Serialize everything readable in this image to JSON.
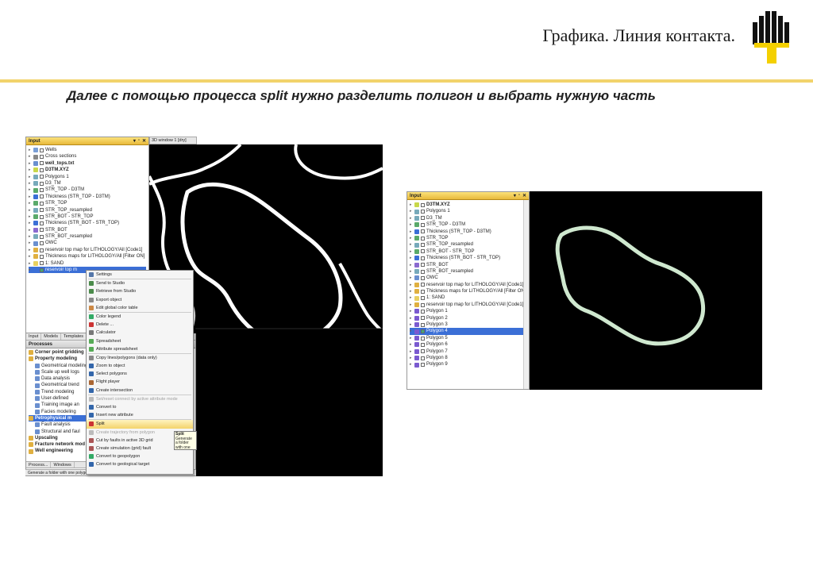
{
  "slide": {
    "title": "Графика. Линия контакта.",
    "subtitle": "Далее с помощью процесса split нужно разделить полигон и выбрать нужную часть",
    "accent_color": "#f2d36b"
  },
  "left_window": {
    "title": "Input",
    "window_tab": "3D window 1 [dry]",
    "tree": [
      {
        "label": "Wells",
        "icon": "#7a9fd6",
        "bold": false
      },
      {
        "label": "Cross sections",
        "icon": "#888",
        "bold": false
      },
      {
        "label": "well_tops.txt",
        "icon": "#6a8fcf",
        "bold": true
      },
      {
        "label": "D3TM.XYZ",
        "icon": "#c8d84a",
        "bold": true
      },
      {
        "label": "Polygons 1",
        "icon": "#7ab",
        "bold": false
      },
      {
        "label": "D3_TM",
        "icon": "#7ab",
        "bold": false
      },
      {
        "label": "STR_TOP - D3TM",
        "icon": "#5aaa6a",
        "bold": false
      },
      {
        "label": "Thickness (STR_TOP - D3TM)",
        "icon": "#3b6fd6",
        "bold": false
      },
      {
        "label": "STR_TOP",
        "icon": "#5aaa6a",
        "bold": false
      },
      {
        "label": "STR_TOP_resampled",
        "icon": "#7ab",
        "bold": false
      },
      {
        "label": "STR_BOT - STR_TOP",
        "icon": "#5aaa6a",
        "bold": false
      },
      {
        "label": "Thickness (STR_BOT - STR_TOP)",
        "icon": "#3b6fd6",
        "bold": false
      },
      {
        "label": "STR_BOT",
        "icon": "#8a6ad0",
        "bold": false
      },
      {
        "label": "STR_BOT_resampled",
        "icon": "#7ab",
        "bold": false
      },
      {
        "label": "OWC",
        "icon": "#6a8fcf",
        "bold": false
      },
      {
        "label": "reservoir top map for LITHOLOGY/All [Code1]",
        "icon": "#e0b040",
        "bold": false
      },
      {
        "label": "Thickness maps for LITHOLOGY/All [Filter ON]",
        "icon": "#e0b040",
        "bold": false
      },
      {
        "label": "1: SAND",
        "icon": "#e8d060",
        "bold": false
      },
      {
        "label": "reservoir top m",
        "icon": "#3b6fd6",
        "bold": false,
        "selected": true
      }
    ],
    "bottom_tabs": [
      "Input",
      "Models",
      "Templates"
    ],
    "processes_title": "Processes",
    "processes": [
      {
        "label": "Corner point gridding",
        "bold": true
      },
      {
        "label": "Property modeling",
        "bold": true
      },
      {
        "label": "Geometrical modeling",
        "bold": false
      },
      {
        "label": "Scale up well logs",
        "bold": false
      },
      {
        "label": "Data analysis",
        "bold": false
      },
      {
        "label": "Geometrical trend",
        "bold": false
      },
      {
        "label": "Trend modeling",
        "bold": false
      },
      {
        "label": "User-defined",
        "bold": false
      },
      {
        "label": "Training image an",
        "bold": false
      },
      {
        "label": "Facies modeling",
        "bold": false
      },
      {
        "label": "Petrophysical m",
        "bold": true,
        "selected": true
      },
      {
        "label": "Fault analysis",
        "bold": false
      },
      {
        "label": "Structural and faul",
        "bold": false
      },
      {
        "label": "Upscaling",
        "bold": true
      },
      {
        "label": "Fracture network mod",
        "bold": true
      },
      {
        "label": "Well engineering",
        "bold": true
      }
    ],
    "footer_tabs": [
      "Process...",
      "Windows"
    ],
    "status_text": "Generate a folder with one polygon object as a separate Petrel object"
  },
  "context_menu": [
    {
      "label": "Settings",
      "icon": "#5577aa",
      "disabled": false
    },
    {
      "label": "Send to Studio",
      "icon": "#4a8a4a",
      "disabled": false
    },
    {
      "label": "Retrieve from Studio",
      "icon": "#4a8a4a",
      "disabled": false
    },
    {
      "label": "Export object",
      "icon": "#888",
      "disabled": false
    },
    {
      "label": "Edit global color table",
      "icon": "#c84",
      "disabled": false
    },
    {
      "label": "Color legend",
      "icon": "#3a6",
      "disabled": false
    },
    {
      "label": "Delete ...",
      "icon": "#c33",
      "disabled": false
    },
    {
      "label": "Calculator",
      "icon": "#777",
      "disabled": false
    },
    {
      "label": "Spreadsheet",
      "icon": "#5a5",
      "disabled": false
    },
    {
      "label": "Attribute spreadsheet",
      "icon": "#5a5",
      "disabled": false
    },
    {
      "label": "Copy lines/polygons (data only)",
      "icon": "#888",
      "disabled": false
    },
    {
      "label": "Zoom to object",
      "icon": "#36a",
      "disabled": false
    },
    {
      "label": "Select polygons",
      "icon": "#36a",
      "disabled": false
    },
    {
      "label": "Flight player",
      "icon": "#a63",
      "disabled": false
    },
    {
      "label": "Create intersection",
      "icon": "#36a",
      "disabled": false
    },
    {
      "label": "Set/reset connect by active attribute mode",
      "icon": "#bbb",
      "disabled": true
    },
    {
      "label": "Convert to",
      "icon": "#36a",
      "disabled": false
    },
    {
      "label": "Insert new attribute",
      "icon": "#36a",
      "disabled": false
    },
    {
      "label": "Split",
      "icon": "#c33",
      "disabled": false,
      "highlighted": true
    },
    {
      "label": "Create trajectory from polygon",
      "icon": "#bbb",
      "disabled": true
    },
    {
      "label": "Cut by faults in active 3D grid",
      "icon": "#a55",
      "disabled": false
    },
    {
      "label": "Create simulation (grid) fault",
      "icon": "#a55",
      "disabled": false
    },
    {
      "label": "Convert to geopolygon",
      "icon": "#3a6",
      "disabled": false
    },
    {
      "label": "Convert to geological target",
      "icon": "#36a",
      "disabled": false
    }
  ],
  "tooltip": {
    "title": "Split",
    "body": "Generate a folder with one polygon object as a separate Petrel object"
  },
  "right_window": {
    "title": "Input",
    "tree": [
      {
        "label": "D3TM.XYZ",
        "icon": "#c8d84a",
        "bold": true
      },
      {
        "label": "Polygons 1",
        "icon": "#7ab",
        "bold": false
      },
      {
        "label": "D3_TM",
        "icon": "#7ab",
        "bold": false
      },
      {
        "label": "STR_TOP - D3TM",
        "icon": "#5aaa6a",
        "bold": false
      },
      {
        "label": "Thickness (STR_TOP - D3TM)",
        "icon": "#3b6fd6",
        "bold": false
      },
      {
        "label": "STR_TOP",
        "icon": "#5aaa6a",
        "bold": false
      },
      {
        "label": "STR_TOP_resampled",
        "icon": "#7ab",
        "bold": false
      },
      {
        "label": "STR_BOT - STR_TOP",
        "icon": "#5aaa6a",
        "bold": false
      },
      {
        "label": "Thickness (STR_BOT - STR_TOP)",
        "icon": "#3b6fd6",
        "bold": false
      },
      {
        "label": "STR_BOT",
        "icon": "#8a6ad0",
        "bold": false
      },
      {
        "label": "STR_BOT_resampled",
        "icon": "#7ab",
        "bold": false
      },
      {
        "label": "OWC",
        "icon": "#6a8fcf",
        "bold": false
      },
      {
        "label": "reservoir top map for LITHOLOGY/All [Code1]",
        "icon": "#e0b040",
        "bold": false
      },
      {
        "label": "Thickness maps for LITHOLOGY/All [Filter ON]",
        "icon": "#e0b040",
        "bold": false
      },
      {
        "label": "1: SAND",
        "icon": "#e8d060",
        "bold": false
      },
      {
        "label": "reservoir top map for LITHOLOGY/All [Code1]",
        "icon": "#e0b040",
        "bold": false
      },
      {
        "label": "Polygon 1",
        "icon": "#7a5ad0",
        "bold": false
      },
      {
        "label": "Polygon 2",
        "icon": "#7a5ad0",
        "bold": false
      },
      {
        "label": "Polygon 3",
        "icon": "#7a5ad0",
        "bold": false
      },
      {
        "label": "Polygon 4",
        "icon": "#7a5ad0",
        "bold": false,
        "selected": true
      },
      {
        "label": "Polygon 5",
        "icon": "#7a5ad0",
        "bold": false
      },
      {
        "label": "Polygon 6",
        "icon": "#7a5ad0",
        "bold": false
      },
      {
        "label": "Polygon 7",
        "icon": "#7a5ad0",
        "bold": false
      },
      {
        "label": "Polygon 8",
        "icon": "#7a5ad0",
        "bold": false
      },
      {
        "label": "Polygon 9",
        "icon": "#7a5ad0",
        "bold": false
      }
    ]
  }
}
